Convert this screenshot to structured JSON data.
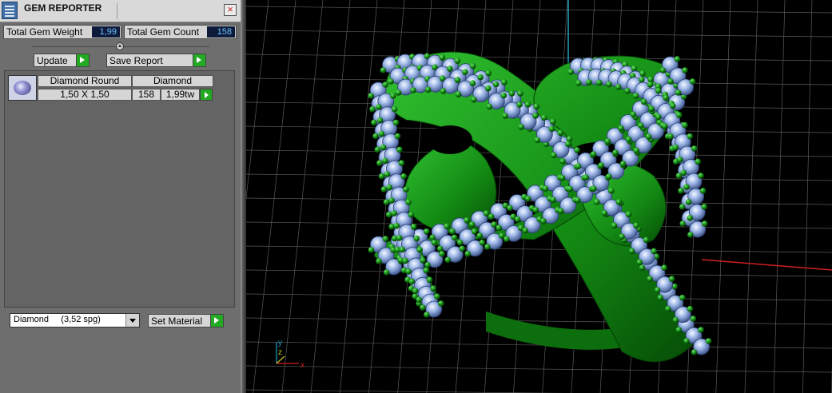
{
  "panel": {
    "title": "GEM REPORTER",
    "close_glyph": "×",
    "total_weight": {
      "label": "Total Gem Weight",
      "value": "1,99"
    },
    "total_count": {
      "label": "Total Gem Count",
      "value": "158"
    },
    "update_label": "Update",
    "save_report_label": "Save Report",
    "gem_list": [
      {
        "shape": "Diamond Round",
        "material": "Diamond",
        "size": "1,50 X 1,50",
        "count": "158",
        "weight": "1,99tw"
      }
    ],
    "material_select": {
      "value": "Diamond     (3,52 spg)"
    },
    "set_material_label": "Set Material"
  },
  "viewport": {
    "axis_labels": {
      "x": "x",
      "y": "y",
      "z": "z"
    },
    "colors": {
      "background": "#000000",
      "grid": "#5a5a5a",
      "metal": "#1f9b1f",
      "gem": "#9fb8e8",
      "prong": "#106010",
      "axis_x": "#d02020",
      "axis_y": "#20a0c0"
    },
    "icons": [
      "gem-thumbnail-icon",
      "app-icon",
      "close-icon",
      "play-arrow-icon",
      "dropdown-arrow-icon"
    ]
  }
}
